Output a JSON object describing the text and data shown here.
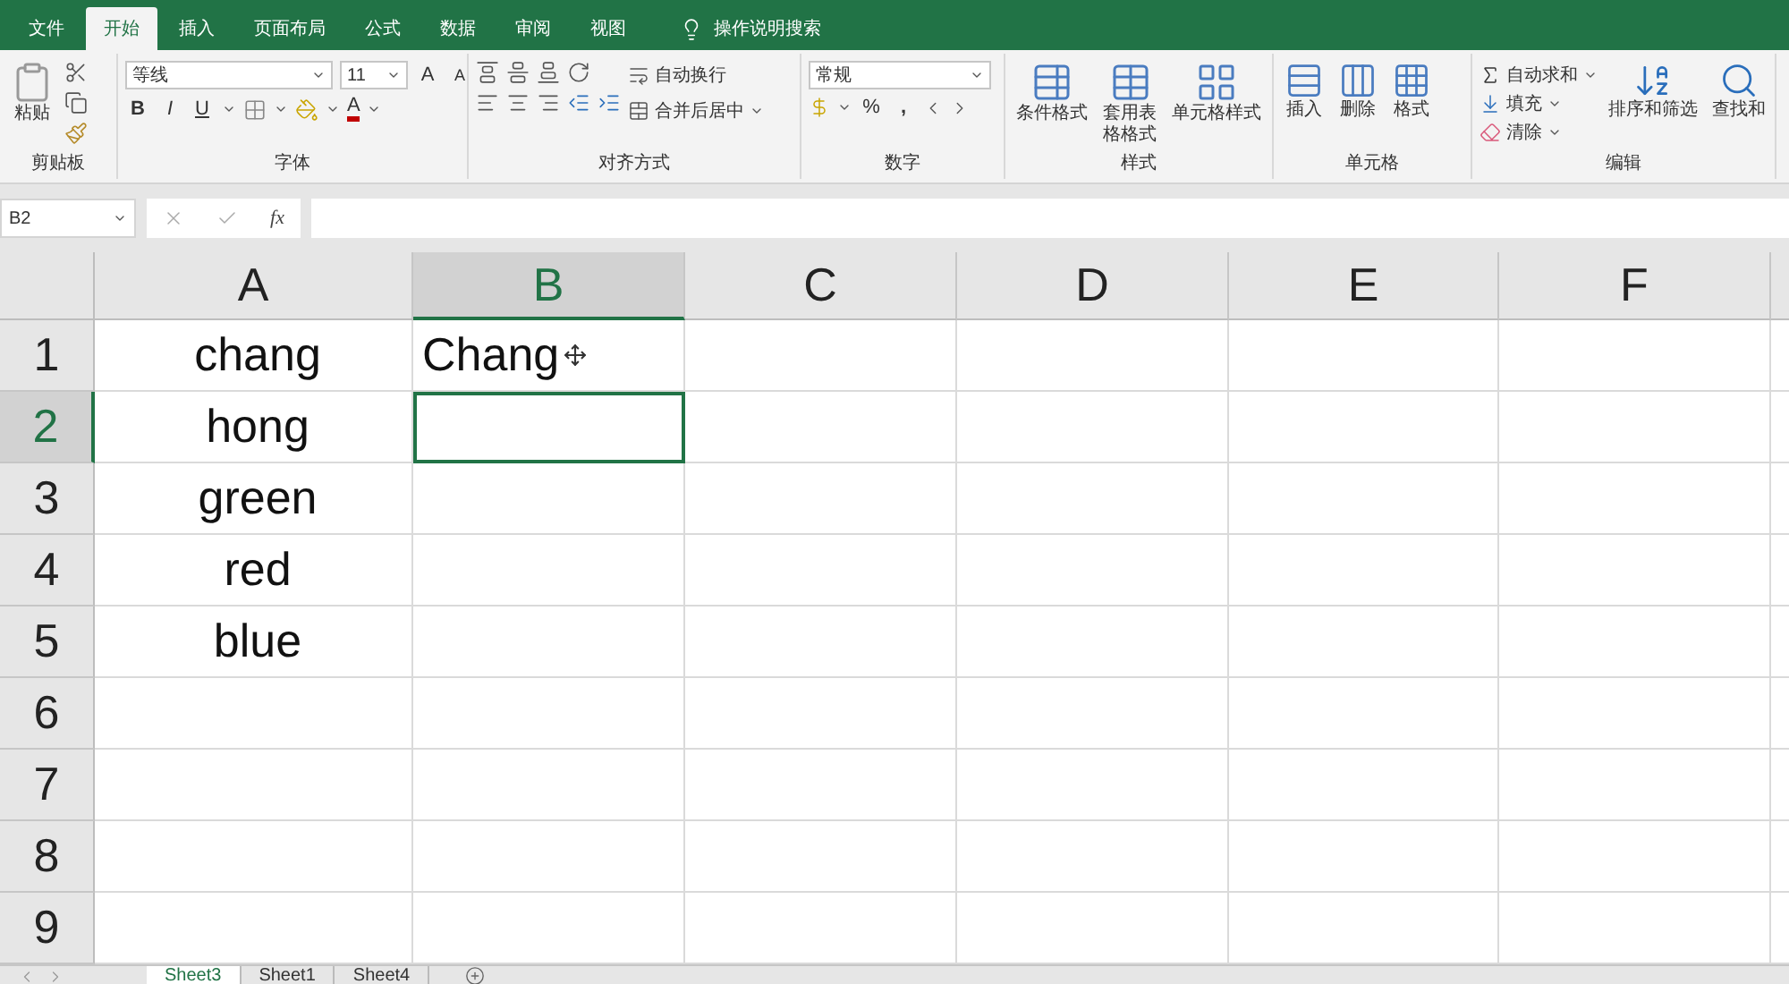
{
  "menu_tabs": [
    {
      "label": "文件",
      "selected": false
    },
    {
      "label": "开始",
      "selected": true
    },
    {
      "label": "插入",
      "selected": false
    },
    {
      "label": "页面布局",
      "selected": false
    },
    {
      "label": "公式",
      "selected": false
    },
    {
      "label": "数据",
      "selected": false
    },
    {
      "label": "审阅",
      "selected": false
    },
    {
      "label": "视图",
      "selected": false
    }
  ],
  "tell_me": "操作说明搜索",
  "ribbon": {
    "clipboard": {
      "label": "剪贴板",
      "paste": "粘贴"
    },
    "font": {
      "label": "字体",
      "font_name": "等线",
      "font_size": "11",
      "grow": "A",
      "shrink": "A",
      "bold": "B",
      "italic": "I",
      "underline": "U",
      "font_color_letter": "A"
    },
    "alignment": {
      "label": "对齐方式",
      "wrap_text": "自动换行",
      "merge": "合并后居中"
    },
    "number": {
      "label": "数字",
      "format": "常规",
      "percent": "%",
      "comma": ","
    },
    "styles": {
      "label": "样式",
      "buttons": [
        "条件格式",
        "套用表格格式",
        "单元格样式"
      ]
    },
    "cells": {
      "label": "单元格",
      "buttons": [
        "插入",
        "删除",
        "格式"
      ]
    },
    "editing": {
      "label": "编辑",
      "items": [
        "自动求和",
        "填充",
        "清除"
      ],
      "buttons": [
        "排序和筛选",
        "查找和"
      ]
    }
  },
  "formula_bar": {
    "name_box": "B2",
    "fx": "fx"
  },
  "grid": {
    "columns": [
      {
        "label": "A",
        "selected": false
      },
      {
        "label": "B",
        "selected": true
      },
      {
        "label": "C",
        "selected": false
      },
      {
        "label": "D",
        "selected": false
      },
      {
        "label": "E",
        "selected": false
      },
      {
        "label": "F",
        "selected": false
      }
    ],
    "rows": [
      {
        "header": "1",
        "selected": false,
        "cells": [
          {
            "text": "chang",
            "selected": false
          },
          {
            "text": "Chang",
            "selected": false
          }
        ]
      },
      {
        "header": "2",
        "selected": true,
        "cells": [
          {
            "text": "hong",
            "selected": false
          },
          {
            "selected": true
          }
        ]
      },
      {
        "header": "3",
        "selected": false,
        "cells": [
          {
            "text": "green",
            "selected": false
          },
          {
            "selected": false
          }
        ]
      },
      {
        "header": "4",
        "selected": false,
        "cells": [
          {
            "text": "red",
            "selected": false
          },
          {
            "selected": false
          }
        ]
      },
      {
        "header": "5",
        "selected": false,
        "cells": [
          {
            "text": "blue",
            "selected": false
          },
          {
            "selected": false
          }
        ]
      },
      {
        "header": "6",
        "selected": false,
        "cells": []
      },
      {
        "header": "7",
        "selected": false,
        "cells": []
      },
      {
        "header": "8",
        "selected": false,
        "cells": []
      },
      {
        "header": "9",
        "selected": false,
        "cells": []
      }
    ]
  },
  "sheets": [
    {
      "label": "Sheet3",
      "selected": true
    },
    {
      "label": "Sheet1",
      "selected": false
    },
    {
      "label": "Sheet4",
      "selected": false
    }
  ]
}
